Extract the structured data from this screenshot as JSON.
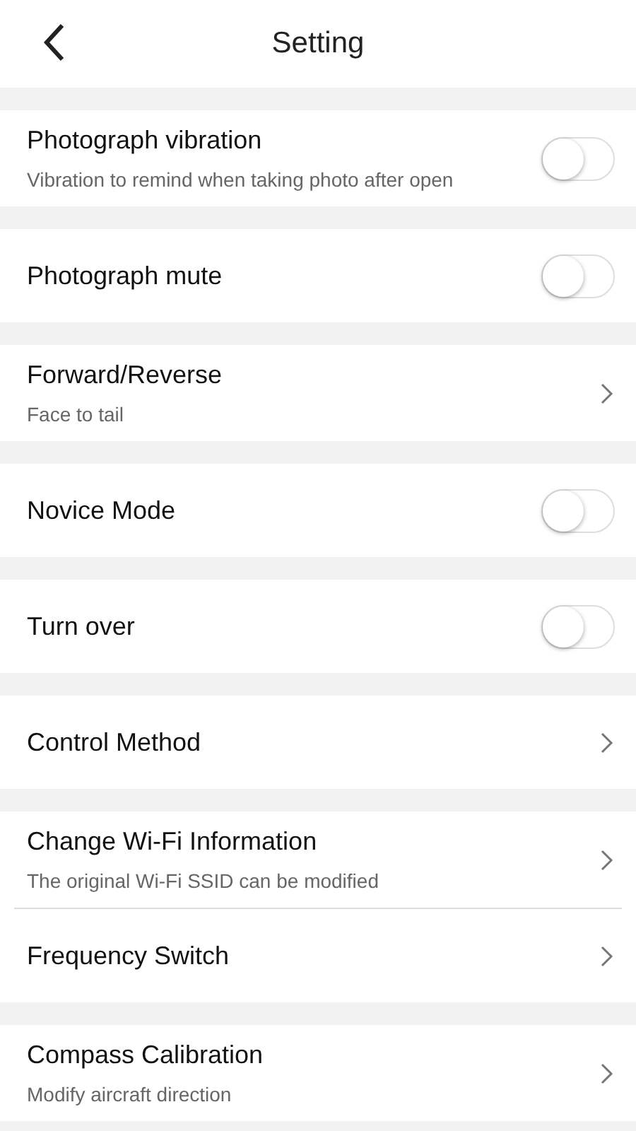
{
  "header": {
    "title": "Setting"
  },
  "groups": [
    {
      "rows": [
        {
          "kind": "toggle",
          "title": "Photograph vibration",
          "subtitle": "Vibration to remind when taking photo after open",
          "on": false
        }
      ]
    },
    {
      "rows": [
        {
          "kind": "toggle",
          "title": "Photograph mute",
          "on": false
        }
      ]
    },
    {
      "rows": [
        {
          "kind": "link",
          "title": "Forward/Reverse",
          "subtitle": "Face to tail"
        }
      ]
    },
    {
      "rows": [
        {
          "kind": "toggle",
          "title": "Novice Mode",
          "on": false
        }
      ]
    },
    {
      "rows": [
        {
          "kind": "toggle",
          "title": "Turn over",
          "on": false
        }
      ]
    },
    {
      "rows": [
        {
          "kind": "link",
          "title": "Control Method"
        }
      ]
    },
    {
      "rows": [
        {
          "kind": "link",
          "title": "Change Wi-Fi Information",
          "subtitle": "The original Wi-Fi SSID can be modified"
        },
        {
          "kind": "link",
          "title": "Frequency Switch"
        }
      ]
    },
    {
      "rows": [
        {
          "kind": "link",
          "title": "Compass Calibration",
          "subtitle": "Modify aircraft direction"
        }
      ]
    }
  ]
}
